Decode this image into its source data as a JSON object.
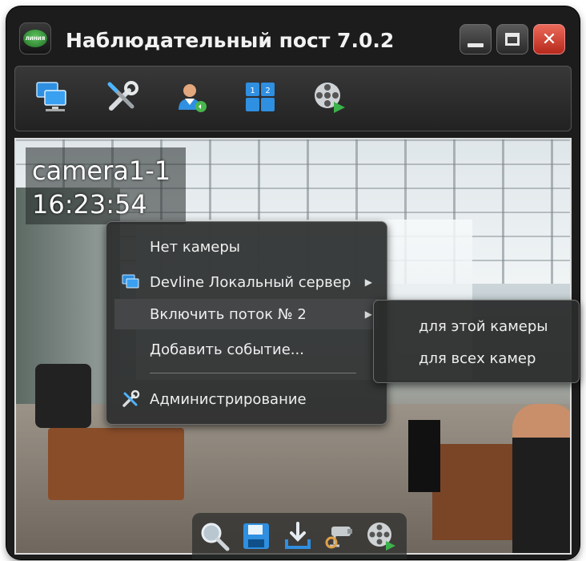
{
  "app": {
    "logo_text": "ЛИНИЯ",
    "title": "Наблюдательный пост 7.0.2"
  },
  "window_controls": {
    "minimize": "minimize-icon",
    "maximize": "maximize-icon",
    "close": "close-icon",
    "close_color": "#d63c2c"
  },
  "toolbar": {
    "items": [
      {
        "icon": "servers-icon"
      },
      {
        "icon": "settings-tools-icon"
      },
      {
        "icon": "user-switch-icon"
      },
      {
        "icon": "layout-grid-icon"
      },
      {
        "icon": "playback-film-icon"
      }
    ]
  },
  "video": {
    "camera_name": "camera1-1",
    "time": "16:23:54"
  },
  "context_menu": {
    "items": [
      {
        "label": "Нет камеры"
      },
      {
        "label": "Devline Локальный сервер",
        "icon": "server-icon"
      },
      {
        "label": "Включить поток № 2"
      },
      {
        "label": "Добавить событие..."
      },
      {
        "label": "Администрирование",
        "icon": "tools-icon"
      }
    ],
    "submenu": [
      {
        "label": "для этой камеры"
      },
      {
        "label": "для всех камер"
      }
    ]
  },
  "bottom_toolbar": {
    "items": [
      {
        "icon": "zoom-icon"
      },
      {
        "icon": "save-icon"
      },
      {
        "icon": "export-icon"
      },
      {
        "icon": "ptz-camera-icon"
      },
      {
        "icon": "playback-film-icon"
      }
    ]
  },
  "colors": {
    "accent_blue": "#2f8fe0",
    "menu_bg": "#2a2c2c",
    "highlight": "#444647"
  }
}
